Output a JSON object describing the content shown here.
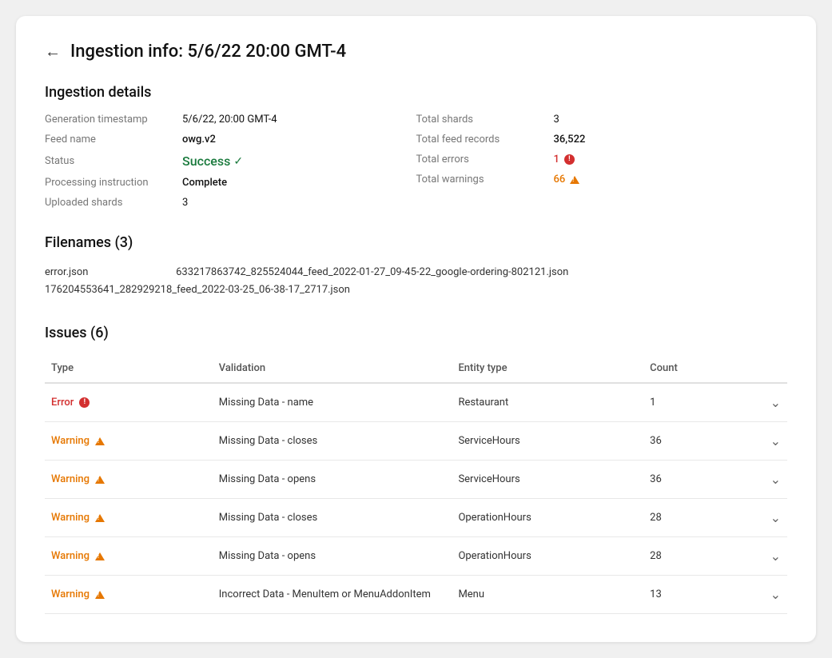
{
  "page": {
    "title": "Ingestion info: 5/6/22 20:00 GMT-4",
    "back_label": "←"
  },
  "ingestion_details": {
    "section_title": "Ingestion details",
    "left": {
      "generation_timestamp_label": "Generation timestamp",
      "generation_timestamp_value": "5/6/22, 20:00 GMT-4",
      "feed_name_label": "Feed name",
      "feed_name_value": "owg.v2",
      "status_label": "Status",
      "status_value": "Success",
      "processing_instruction_label": "Processing instruction",
      "processing_instruction_value": "Complete",
      "uploaded_shards_label": "Uploaded shards",
      "uploaded_shards_value": "3"
    },
    "right": {
      "total_shards_label": "Total shards",
      "total_shards_value": "3",
      "total_feed_records_label": "Total feed records",
      "total_feed_records_value": "36,522",
      "total_errors_label": "Total errors",
      "total_errors_value": "1",
      "total_warnings_label": "Total warnings",
      "total_warnings_value": "66"
    }
  },
  "filenames": {
    "section_title": "Filenames (3)",
    "files": [
      "error.json",
      "633217863742_825524044_feed_2022-01-27_09-45-22_google-ordering-802121.json",
      "176204553641_282929218_feed_2022-03-25_06-38-17_2717.json"
    ]
  },
  "issues": {
    "section_title": "Issues (6)",
    "columns": {
      "type": "Type",
      "validation": "Validation",
      "entity_type": "Entity type",
      "count": "Count"
    },
    "rows": [
      {
        "type": "Error",
        "type_severity": "error",
        "validation": "Missing Data - name",
        "entity_type": "Restaurant",
        "count": "1"
      },
      {
        "type": "Warning",
        "type_severity": "warning",
        "validation": "Missing Data - closes",
        "entity_type": "ServiceHours",
        "count": "36"
      },
      {
        "type": "Warning",
        "type_severity": "warning",
        "validation": "Missing Data - opens",
        "entity_type": "ServiceHours",
        "count": "36"
      },
      {
        "type": "Warning",
        "type_severity": "warning",
        "validation": "Missing Data - closes",
        "entity_type": "OperationHours",
        "count": "28"
      },
      {
        "type": "Warning",
        "type_severity": "warning",
        "validation": "Missing Data - opens",
        "entity_type": "OperationHours",
        "count": "28"
      },
      {
        "type": "Warning",
        "type_severity": "warning",
        "validation": "Incorrect Data - MenuItem or MenuAddonItem",
        "entity_type": "Menu",
        "count": "13"
      }
    ]
  }
}
